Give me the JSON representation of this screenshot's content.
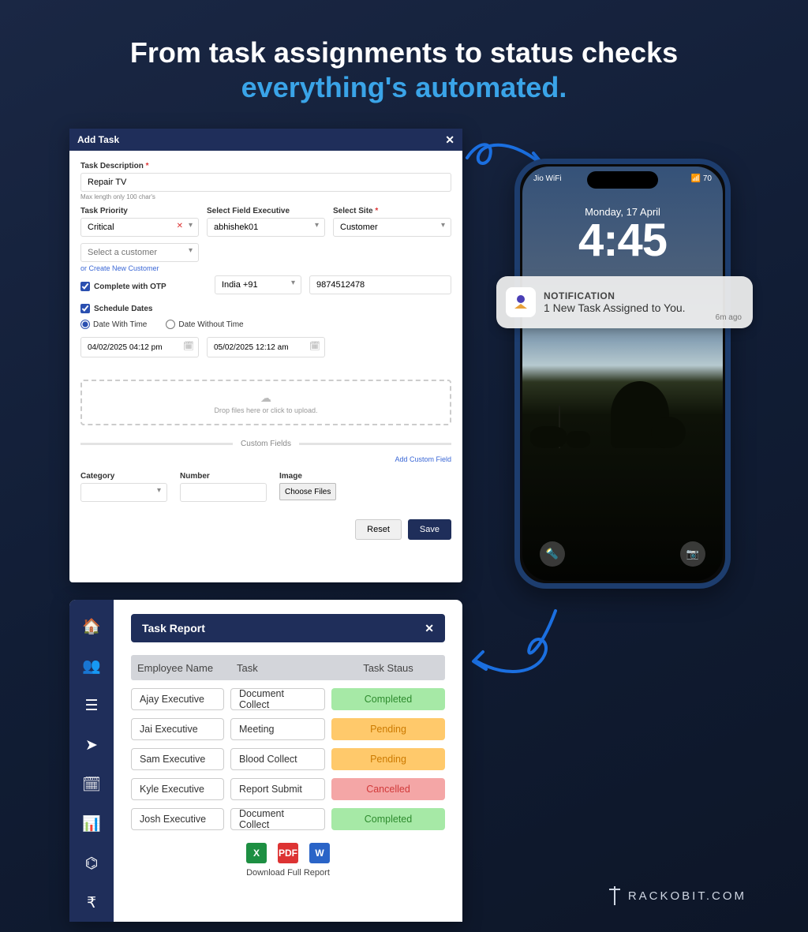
{
  "headline": {
    "line1": "From task assignments to status checks",
    "line2": "everything's automated."
  },
  "addtask": {
    "title": "Add Task",
    "desc_label": "Task Description",
    "desc_value": "Repair TV",
    "desc_hint": "Max length only 100 char's",
    "priority_label": "Task Priority",
    "priority_value": "Critical",
    "exec_label": "Select Field Executive",
    "exec_value": "abhishek01",
    "site_label": "Select Site",
    "site_value": "Customer",
    "customer_ph": "Select a customer",
    "create_link": "or Create New Customer",
    "otp_label": "Complete with OTP",
    "country_value": "India +91",
    "phone_value": "9874512478",
    "schedule_label": "Schedule Dates",
    "date_with": "Date With Time",
    "date_without": "Date Without Time",
    "date1": "04/02/2025 04:12 pm",
    "date2": "05/02/2025 12:12 am",
    "drop_text": "Drop files here or click to upload.",
    "custom_label": "Custom Fields",
    "add_custom": "Add Custom Field",
    "cat_label": "Category",
    "num_label": "Number",
    "img_label": "Image",
    "choose": "Choose Files",
    "reset": "Reset",
    "save": "Save"
  },
  "phone": {
    "carrier": "Jio WiFi",
    "battery": "70",
    "date": "Monday, 17 April",
    "time": "4:45"
  },
  "notification": {
    "title": "NOTIFICATION",
    "body": "1 New Task Assigned to You.",
    "age": "6m ago"
  },
  "report": {
    "title": "Task Report",
    "cols": {
      "c1": "Employee Name",
      "c2": "Task",
      "c3": "Task Staus"
    },
    "rows": [
      {
        "emp": "Ajay Executive",
        "task": "Document Collect",
        "status": "Completed",
        "cls": "completed"
      },
      {
        "emp": "Jai Executive",
        "task": "Meeting",
        "status": "Pending",
        "cls": "pending"
      },
      {
        "emp": "Sam Executive",
        "task": "Blood Collect",
        "status": "Pending",
        "cls": "pending"
      },
      {
        "emp": "Kyle Executive",
        "task": "Report Submit",
        "status": "Cancelled",
        "cls": "cancelled"
      },
      {
        "emp": "Josh Executive",
        "task": "Document Collect",
        "status": "Completed",
        "cls": "completed"
      }
    ],
    "download": "Download Full Report"
  },
  "brand": "RACKOBIT.COM"
}
